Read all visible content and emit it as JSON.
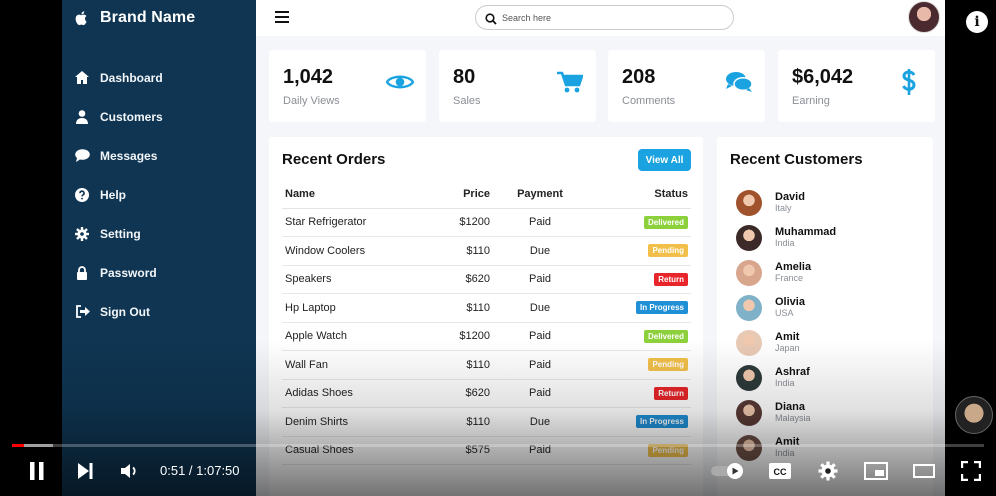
{
  "sidebar": {
    "brand": "Brand Name",
    "items": [
      {
        "label": "Dashboard",
        "icon": "home-icon"
      },
      {
        "label": "Customers",
        "icon": "user-icon"
      },
      {
        "label": "Messages",
        "icon": "chat-icon"
      },
      {
        "label": "Help",
        "icon": "help-icon"
      },
      {
        "label": "Setting",
        "icon": "gear-icon"
      },
      {
        "label": "Password",
        "icon": "lock-icon"
      },
      {
        "label": "Sign Out",
        "icon": "sign-out-icon"
      }
    ]
  },
  "topbar": {
    "search_placeholder": "Search here"
  },
  "cards": [
    {
      "value": "1,042",
      "label": "Daily Views",
      "icon": "eye-icon"
    },
    {
      "value": "80",
      "label": "Sales",
      "icon": "cart-icon"
    },
    {
      "value": "208",
      "label": "Comments",
      "icon": "comments-icon"
    },
    {
      "value": "$6,042",
      "label": "Earning",
      "icon": "dollar-icon"
    }
  ],
  "orders": {
    "title": "Recent Orders",
    "view_all": "View All",
    "columns": [
      "Name",
      "Price",
      "Payment",
      "Status"
    ],
    "rows": [
      {
        "name": "Star Refrigerator",
        "price": "$1200",
        "payment": "Paid",
        "status": "Delivered"
      },
      {
        "name": "Window Coolers",
        "price": "$110",
        "payment": "Due",
        "status": "Pending"
      },
      {
        "name": "Speakers",
        "price": "$620",
        "payment": "Paid",
        "status": "Return"
      },
      {
        "name": "Hp Laptop",
        "price": "$110",
        "payment": "Due",
        "status": "In Progress"
      },
      {
        "name": "Apple Watch",
        "price": "$1200",
        "payment": "Paid",
        "status": "Delivered"
      },
      {
        "name": "Wall Fan",
        "price": "$110",
        "payment": "Paid",
        "status": "Pending"
      },
      {
        "name": "Adidas Shoes",
        "price": "$620",
        "payment": "Paid",
        "status": "Return"
      },
      {
        "name": "Denim Shirts",
        "price": "$110",
        "payment": "Due",
        "status": "In Progress"
      },
      {
        "name": "Casual Shoes",
        "price": "$575",
        "payment": "Paid",
        "status": "Pending"
      }
    ]
  },
  "customers": {
    "title": "Recent Customers",
    "list": [
      {
        "name": "David",
        "country": "Italy"
      },
      {
        "name": "Muhammad",
        "country": "India"
      },
      {
        "name": "Amelia",
        "country": "France"
      },
      {
        "name": "Olivia",
        "country": "USA"
      },
      {
        "name": "Amit",
        "country": "Japan"
      },
      {
        "name": "Ashraf",
        "country": "India"
      },
      {
        "name": "Diana",
        "country": "Malaysia"
      },
      {
        "name": "Amit",
        "country": "India"
      }
    ]
  },
  "status_colors": {
    "Delivered": "#8cd03b",
    "Pending": "#f2c04a",
    "Return": "#e8252a",
    "In Progress": "#1f8fd6"
  },
  "colors": {
    "sidebar": "#0f3552",
    "accent": "#1aa3e0",
    "progress_played": "#ff0000"
  },
  "player": {
    "time": "0:51 / 1:07:50",
    "played_fraction": 0.0125,
    "loaded_fraction": 0.042,
    "info_label": "i"
  }
}
